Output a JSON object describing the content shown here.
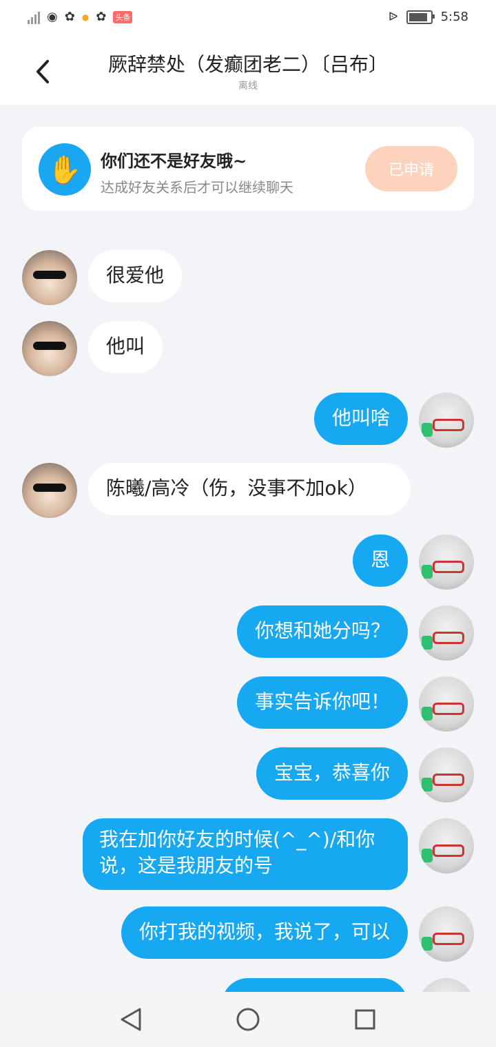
{
  "status": {
    "time": "5:58",
    "badge": "头条"
  },
  "header": {
    "title": "厥辞禁处（发癫团老二）〔吕布〕",
    "subtitle": "离线"
  },
  "notice": {
    "title": "你们还不是好友哦~",
    "text": "达成好友关系后才可以继续聊天",
    "button": "已申请"
  },
  "messages": [
    {
      "side": "in",
      "text": "很爱他"
    },
    {
      "side": "in",
      "text": "他叫"
    },
    {
      "side": "out",
      "text": "他叫啥"
    },
    {
      "side": "in",
      "text": "陈曦/高冷（伤，没事不加ok）"
    },
    {
      "side": "out",
      "text": "恩"
    },
    {
      "side": "out",
      "text": "你想和她分吗？"
    },
    {
      "side": "out",
      "text": "事实告诉你吧！"
    },
    {
      "side": "out",
      "text": "宝宝，恭喜你"
    },
    {
      "side": "out",
      "text": "我在加你好友的时候(^_^)/和你说，这是我朋友的号"
    },
    {
      "side": "out",
      "text": "你打我的视频，我说了，可以"
    }
  ],
  "colors": {
    "outgoing_bubble": "#17a8f2",
    "incoming_bubble": "#ffffff",
    "apply_button": "#fdd3bd"
  }
}
